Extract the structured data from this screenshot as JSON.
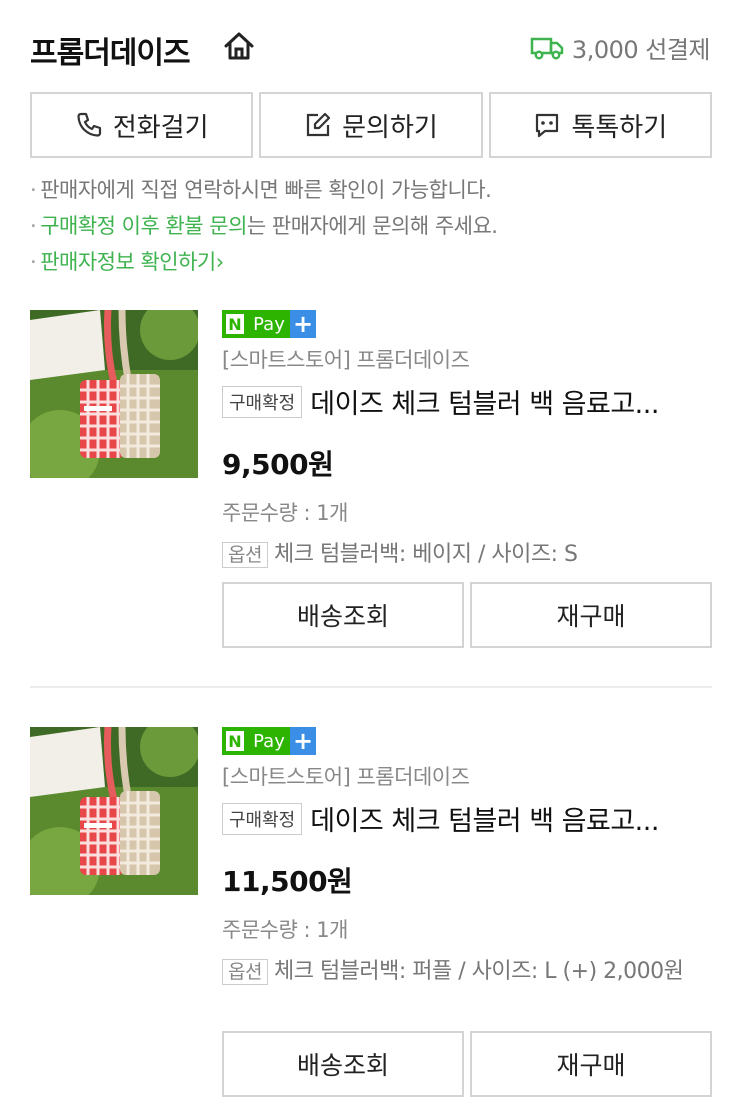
{
  "store": {
    "name": "프롬더데이즈",
    "shipping_fee": "3,000 선결제"
  },
  "contact": {
    "call": "전화걸기",
    "inquiry": "문의하기",
    "talktalk": "톡톡하기"
  },
  "notes": {
    "line1": "판매자에게 직접 연락하시면 빠른 확인이 가능합니다.",
    "line2_highlight": "구매확정 이후 환불 문의",
    "line2_rest": "는 판매자에게 문의해 주세요.",
    "seller_info_link": "판매자정보 확인하기",
    "bullet": "·",
    "chevron": "›"
  },
  "npay": {
    "n": "N",
    "pay": "Pay",
    "plus": "+"
  },
  "orders": [
    {
      "seller": "[스마트스토어] 프롬더데이즈",
      "status_badge": "구매확정",
      "title": "데이즈 체크 텀블러 백 음료고...",
      "price": "9,500원",
      "quantity": "주문수량 : 1개",
      "option_badge": "옵션",
      "option_text": "체크 텀블러백: 베이지 / 사이즈: S",
      "track_label": "배송조회",
      "rebuy_label": "재구매"
    },
    {
      "seller": "[스마트스토어] 프롬더데이즈",
      "status_badge": "구매확정",
      "title": "데이즈 체크 텀블러 백 음료고...",
      "price": "11,500원",
      "quantity": "주문수량 : 1개",
      "option_badge": "옵션",
      "option_text": "체크 텀블러백: 퍼플 / 사이즈: L (+) 2,000원",
      "track_label": "배송조회",
      "rebuy_label": "재구매"
    }
  ],
  "colors": {
    "accent_green": "#3fb34f",
    "npay_green": "#2db400",
    "npay_plus_blue": "#3a8ee6"
  },
  "icons": [
    "home-icon",
    "truck-icon",
    "phone-icon",
    "edit-icon",
    "chat-icon",
    "product-thumbnail"
  ]
}
